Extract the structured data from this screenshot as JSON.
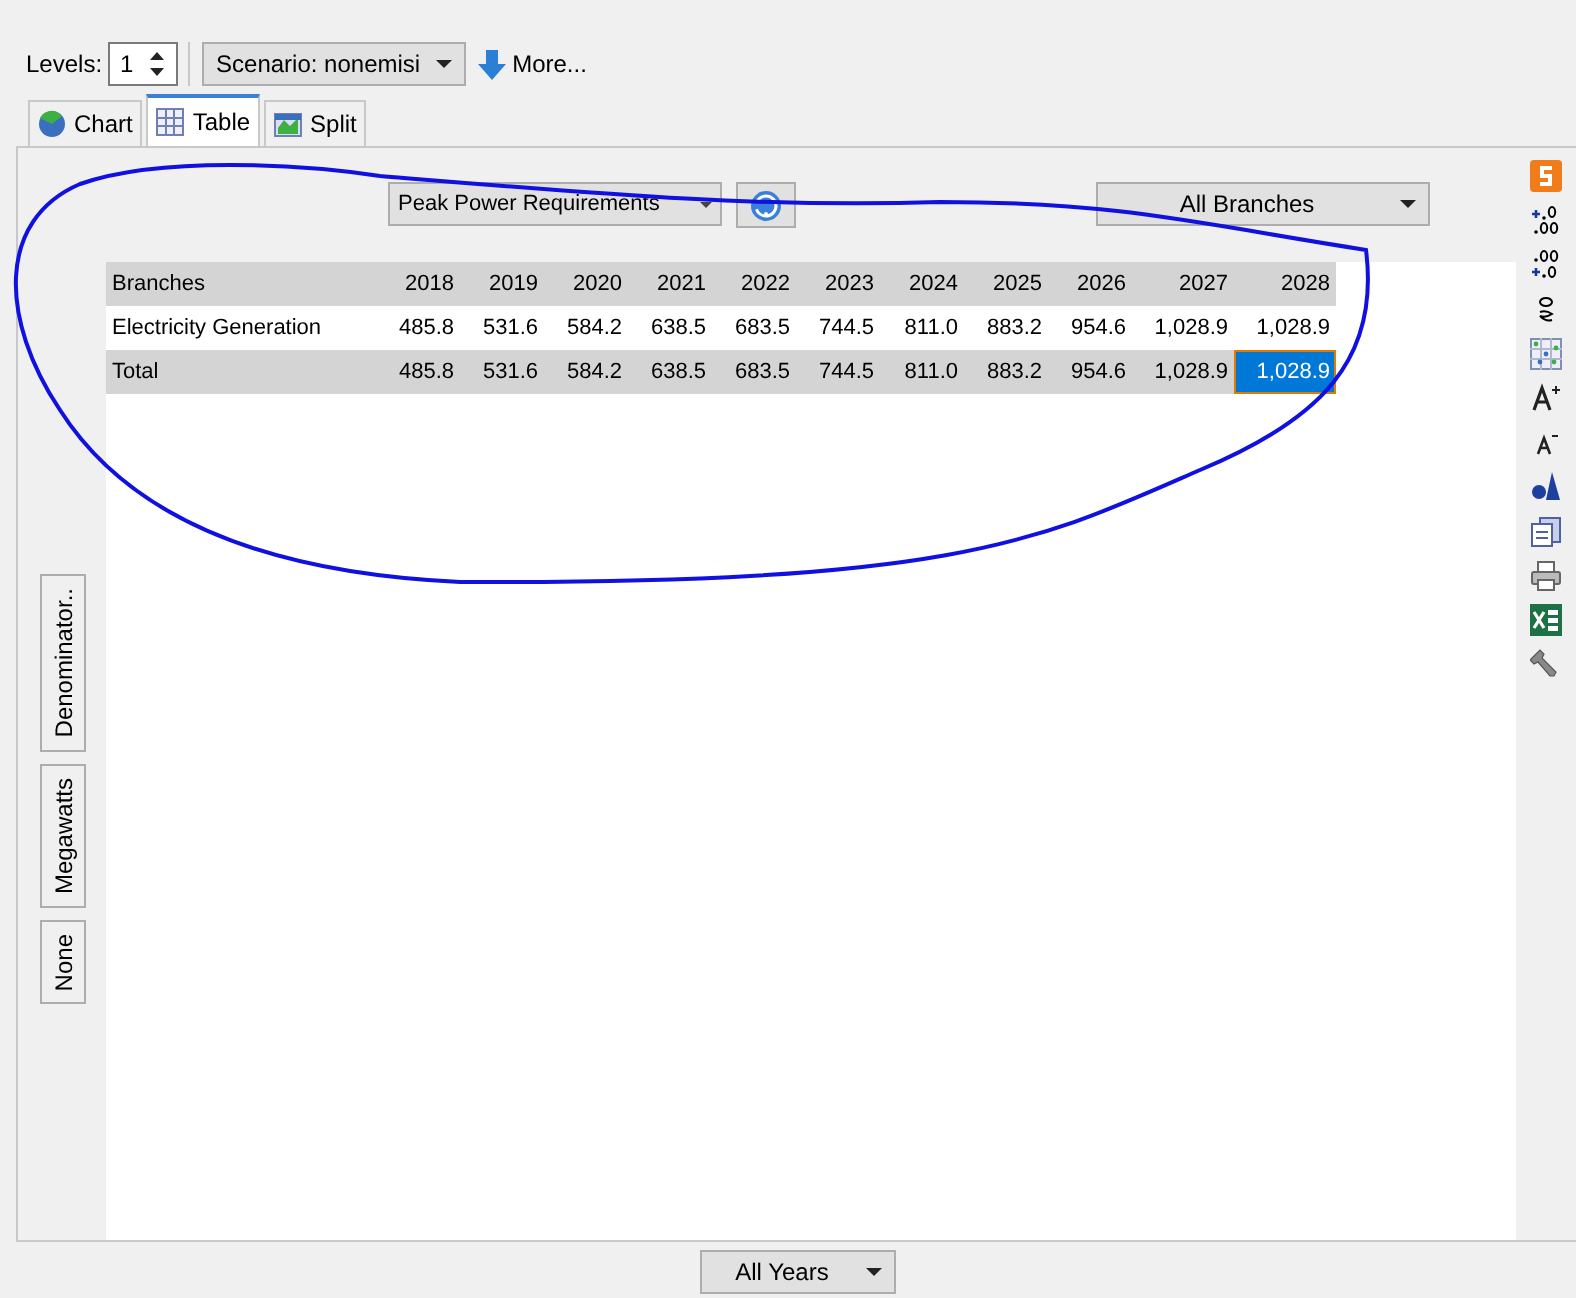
{
  "toolbar": {
    "levels_label": "Levels:",
    "levels_value": "1",
    "scenario": "Scenario: nonemisi",
    "more": "More..."
  },
  "tabs": [
    {
      "label": "Chart",
      "selected": false
    },
    {
      "label": "Table",
      "selected": true
    },
    {
      "label": "Split",
      "selected": false
    }
  ],
  "report": {
    "dropdown": "Peak Power Requirements",
    "branches": "All Branches"
  },
  "table": {
    "columns": [
      "Branches",
      "2018",
      "2019",
      "2020",
      "2021",
      "2022",
      "2023",
      "2024",
      "2025",
      "2026",
      "2027",
      "2028"
    ],
    "rows": [
      {
        "kind": "data",
        "cells": [
          {
            "text": "Electricity Generation",
            "selected": false
          },
          {
            "text": "485.8",
            "selected": false
          },
          {
            "text": "531.6",
            "selected": false
          },
          {
            "text": "584.2",
            "selected": false
          },
          {
            "text": "638.5",
            "selected": false
          },
          {
            "text": "683.5",
            "selected": false
          },
          {
            "text": "744.5",
            "selected": false
          },
          {
            "text": "811.0",
            "selected": false
          },
          {
            "text": "883.2",
            "selected": false
          },
          {
            "text": "954.6",
            "selected": false
          },
          {
            "text": "1,028.9",
            "selected": false
          },
          {
            "text": "1,028.9",
            "selected": false
          }
        ]
      },
      {
        "kind": "total",
        "cells": [
          {
            "text": "Total",
            "selected": false
          },
          {
            "text": "485.8",
            "selected": false
          },
          {
            "text": "531.6",
            "selected": false
          },
          {
            "text": "584.2",
            "selected": false
          },
          {
            "text": "638.5",
            "selected": false
          },
          {
            "text": "683.5",
            "selected": false
          },
          {
            "text": "744.5",
            "selected": false
          },
          {
            "text": "811.0",
            "selected": false
          },
          {
            "text": "883.2",
            "selected": false
          },
          {
            "text": "954.6",
            "selected": false
          },
          {
            "text": "1,028.9",
            "selected": false
          },
          {
            "text": "1,028.9",
            "selected": true
          }
        ]
      }
    ]
  },
  "side_buttons": [
    "Denominator..",
    "Megawatts",
    "None"
  ],
  "footer": {
    "years": "All Years"
  }
}
